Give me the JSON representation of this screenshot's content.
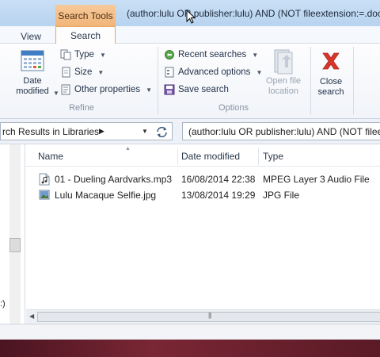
{
  "titlebar": {
    "contextual_tab": "Search Tools",
    "title": "(author:lulu OR publisher:lulu) AND (NOT fileextension:=.docx)"
  },
  "ribbon_tabs": [
    {
      "label": "View"
    },
    {
      "label": "Search"
    }
  ],
  "refine": {
    "date_modified": "Date modified",
    "type": "Type",
    "size": "Size",
    "other_properties": "Other properties",
    "group_label": "Refine"
  },
  "options": {
    "recent_searches": "Recent searches",
    "advanced_options": "Advanced options",
    "save_search": "Save search",
    "open_file_location": "Open file location",
    "group_label": "Options"
  },
  "close_search": "Close search",
  "address": {
    "path": "rch Results in Libraries",
    "search_query": "(author:lulu OR publisher:lulu) AND (NOT fileextension:=.docx)"
  },
  "columns": [
    "Name",
    "Date modified",
    "Type"
  ],
  "files": [
    {
      "name": "01 - Dueling Aardvarks.mp3",
      "date": "16/08/2014 22:38",
      "type": "MPEG Layer 3 Audio File",
      "icon": "audio-file-icon"
    },
    {
      "name": "Lulu Macaque Selfie.jpg",
      "date": "13/08/2014 19:29",
      "type": "JPG File",
      "icon": "image-file-icon"
    }
  ],
  "nav_fragment": ":)",
  "colors": {
    "contextual_tab": "#f1b57a",
    "selected_tab_border": "#e7a862",
    "close_x": "#d9352a"
  }
}
